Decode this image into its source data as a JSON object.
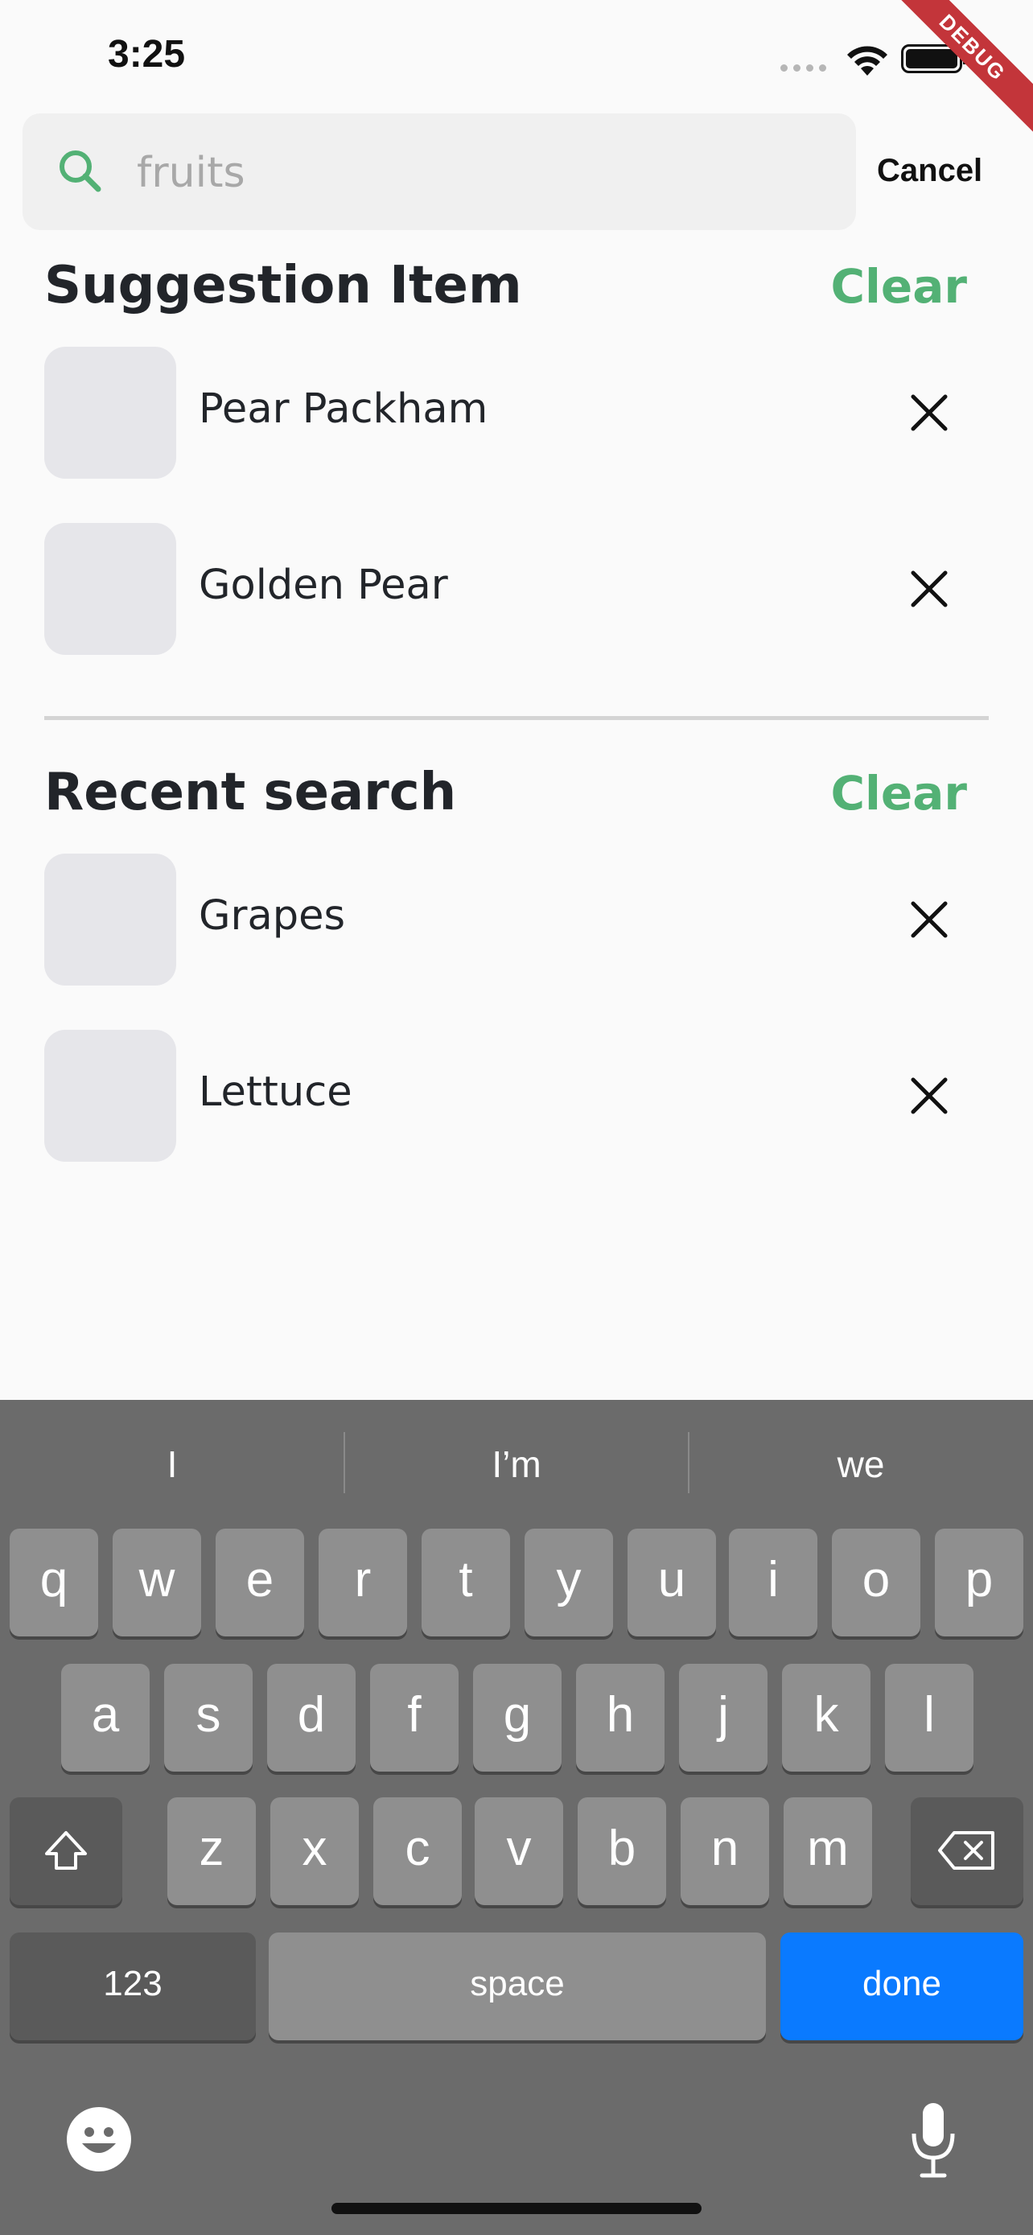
{
  "status_bar": {
    "time": "3:25",
    "debug_label": "DEBUG"
  },
  "search": {
    "placeholder": "fruits",
    "value": "",
    "cancel_label": "Cancel"
  },
  "sections": [
    {
      "title": "Suggestion Item",
      "clear_label": "Clear",
      "items": [
        {
          "label": "Pear Packham"
        },
        {
          "label": "Golden Pear"
        }
      ]
    },
    {
      "title": "Recent search",
      "clear_label": "Clear",
      "items": [
        {
          "label": "Grapes"
        },
        {
          "label": "Lettuce"
        }
      ]
    }
  ],
  "keyboard": {
    "suggestions": [
      "I",
      "I’m",
      "we"
    ],
    "row1": [
      "q",
      "w",
      "e",
      "r",
      "t",
      "y",
      "u",
      "i",
      "o",
      "p"
    ],
    "row2": [
      "a",
      "s",
      "d",
      "f",
      "g",
      "h",
      "j",
      "k",
      "l"
    ],
    "row3": [
      "z",
      "x",
      "c",
      "v",
      "b",
      "n",
      "m"
    ],
    "numbers_label": "123",
    "space_label": "space",
    "done_label": "done"
  },
  "colors": {
    "accent": "#53b175",
    "done_key": "#0a7aff",
    "debug_ribbon": "#c3353a"
  }
}
